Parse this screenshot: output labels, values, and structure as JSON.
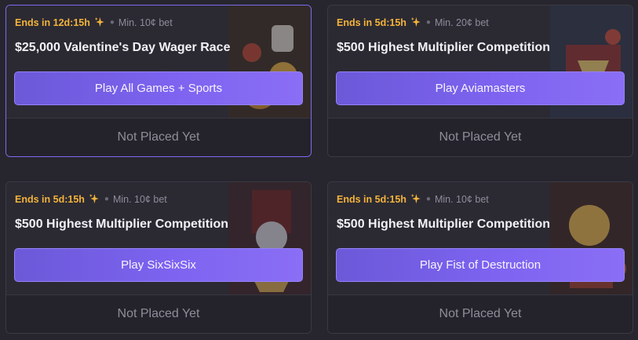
{
  "cards": [
    {
      "ends": "Ends in 12d:15h",
      "min_bet": "Min. 10¢ bet",
      "title": "$25,000 Valentine's Day Wager Race",
      "play_label": "Play All Games + Sports",
      "status": "Not Placed Yet",
      "highlighted": true
    },
    {
      "ends": "Ends in 5d:15h",
      "min_bet": "Min. 20¢ bet",
      "title": "$500 Highest Multiplier Competition",
      "play_label": "Play Aviamasters",
      "status": "Not Placed Yet",
      "highlighted": false
    },
    {
      "ends": "Ends in 5d:15h",
      "min_bet": "Min. 10¢ bet",
      "title": "$500 Highest Multiplier Competition",
      "play_label": "Play SixSixSix",
      "status": "Not Placed Yet",
      "highlighted": false
    },
    {
      "ends": "Ends in 5d:15h",
      "min_bet": "Min. 10¢ bet",
      "title": "$500 Highest Multiplier Competition",
      "play_label": "Play Fist of Destruction",
      "status": "Not Placed Yet",
      "highlighted": false
    }
  ],
  "icons": {
    "timer": "sparkle-icon",
    "separator": "dot-separator"
  },
  "colors": {
    "accent": "#7d63f0",
    "ends_text": "#f4b33a",
    "highlight_border": "#7c6cf0"
  }
}
